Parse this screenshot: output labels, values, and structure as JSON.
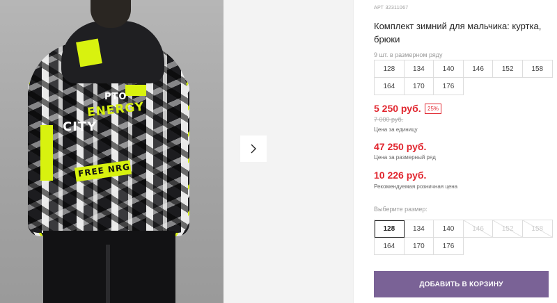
{
  "product": {
    "article_label": "АРТ",
    "article_number": "32311067",
    "title": "Комплект зимний для мальчика: куртка, брюки",
    "print_words": [
      "PTO",
      "ENERGY",
      "CITY",
      "FREE NRG"
    ]
  },
  "pack": {
    "label": "9 шт. в размерном ряду",
    "sizes_row1": [
      "128",
      "134",
      "140",
      "146",
      "152",
      "158"
    ],
    "sizes_row2": [
      "164",
      "170",
      "176"
    ]
  },
  "prices": {
    "unit_price": "5 250 руб.",
    "discount": "25%",
    "old_price": "7 000 руб.",
    "unit_label": "Цена за единицу",
    "pack_price": "47 250 руб.",
    "pack_label": "Цена за размерный ряд",
    "rrp_price": "10 226 руб.",
    "rrp_label": "Рекомендуемая розничная цена"
  },
  "picker": {
    "label": "Выберите размер:",
    "selected": "128",
    "sizes_row1": [
      "128",
      "134",
      "140",
      "146",
      "152",
      "158"
    ],
    "sizes_row2": [
      "164",
      "170",
      "176"
    ],
    "unavailable": [
      "146",
      "152",
      "158"
    ]
  },
  "actions": {
    "add_to_cart": "ДОБАВИТЬ В КОРЗИНУ"
  },
  "colors": {
    "accent_price": "#e1262f",
    "cart_button": "#7a6296",
    "print_neon": "#d8f20f"
  },
  "icons": {
    "next": "chevron-right-icon"
  }
}
